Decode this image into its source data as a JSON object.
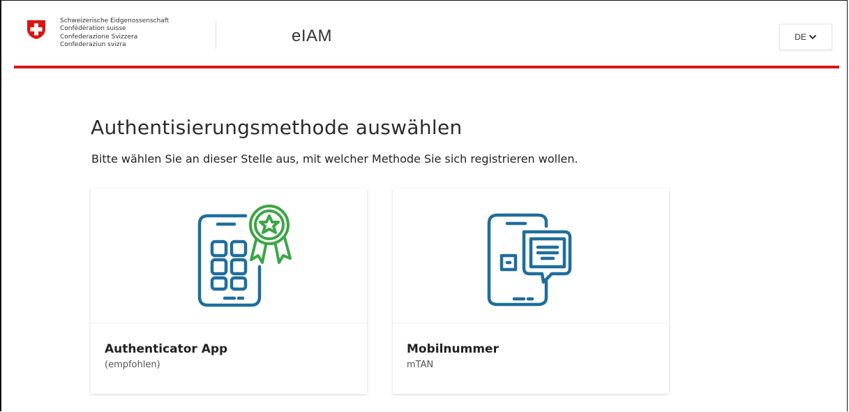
{
  "header": {
    "confederation_lines": [
      "Schweizerische Eidgenossenschaft",
      "Confédération suisse",
      "Confederazione Svizzera",
      "Confederaziun svizra"
    ],
    "app_title": "eIAM",
    "language": "DE",
    "logo_icon": "swiss-coat-of-arms-icon",
    "accent_color": "#dc1414"
  },
  "main": {
    "title": "Authentisierungsmethode auswählen",
    "subtitle": "Bitte wählen Sie an dieser Stelle aus, mit welcher Methode Sie sich registrieren wollen.",
    "methods": [
      {
        "title": "Authenticator App",
        "subtitle": "(empfohlen)",
        "icon": "authenticator-app-icon",
        "icon_color": "#1e6e9c",
        "badge_color": "#3aa645"
      },
      {
        "title": "Mobilnummer",
        "subtitle": "mTAN",
        "icon": "mobile-sms-icon",
        "icon_color": "#1e6e9c"
      }
    ]
  }
}
